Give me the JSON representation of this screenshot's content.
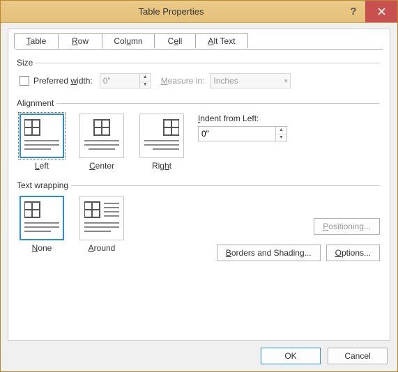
{
  "title": "Table Properties",
  "tabs": {
    "table": "Table",
    "row": "Row",
    "column": "Column",
    "cell": "Cell",
    "alttext": "Alt Text"
  },
  "size": {
    "legend": "Size",
    "preferred_width_label": "Preferred width:",
    "preferred_width_value": "0\"",
    "measure_in_label": "Measure in:",
    "measure_in_value": "Inches"
  },
  "alignment": {
    "legend": "Alignment",
    "left": "Left",
    "center": "Center",
    "right": "Right",
    "indent_label": "Indent from Left:",
    "indent_value": "0\""
  },
  "wrap": {
    "legend": "Text wrapping",
    "none": "None",
    "around": "Around"
  },
  "buttons": {
    "positioning": "Positioning...",
    "borders": "Borders and Shading...",
    "options": "Options...",
    "ok": "OK",
    "cancel": "Cancel"
  }
}
